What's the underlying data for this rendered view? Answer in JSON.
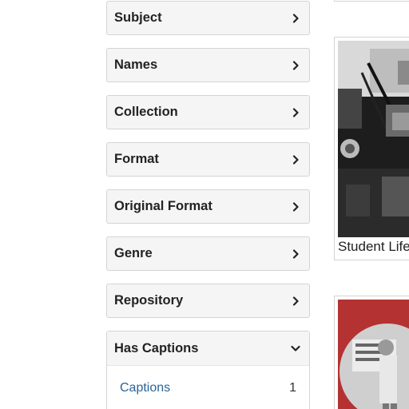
{
  "facets": [
    {
      "label": "Subject",
      "icon": "chevron-right-icon"
    },
    {
      "label": "Names",
      "icon": "chevron-right-icon"
    },
    {
      "label": "Collection",
      "icon": "chevron-right-icon"
    },
    {
      "label": "Format",
      "icon": "chevron-right-icon"
    },
    {
      "label": "Original Format",
      "icon": "chevron-right-icon"
    },
    {
      "label": "Genre",
      "icon": "chevron-right-icon"
    },
    {
      "label": "Repository",
      "icon": "chevron-right-icon"
    }
  ],
  "open_facet": {
    "label": "Has Captions",
    "icon": "chevron-down-icon",
    "values": [
      {
        "label": "Captions",
        "count": "1"
      }
    ]
  },
  "results": [
    {
      "caption": "Student Life"
    },
    {
      "caption": ""
    }
  ],
  "colors": {
    "facet_bg": "#f5f5f5",
    "border": "#d4d4d4",
    "link": "#2a6496"
  }
}
